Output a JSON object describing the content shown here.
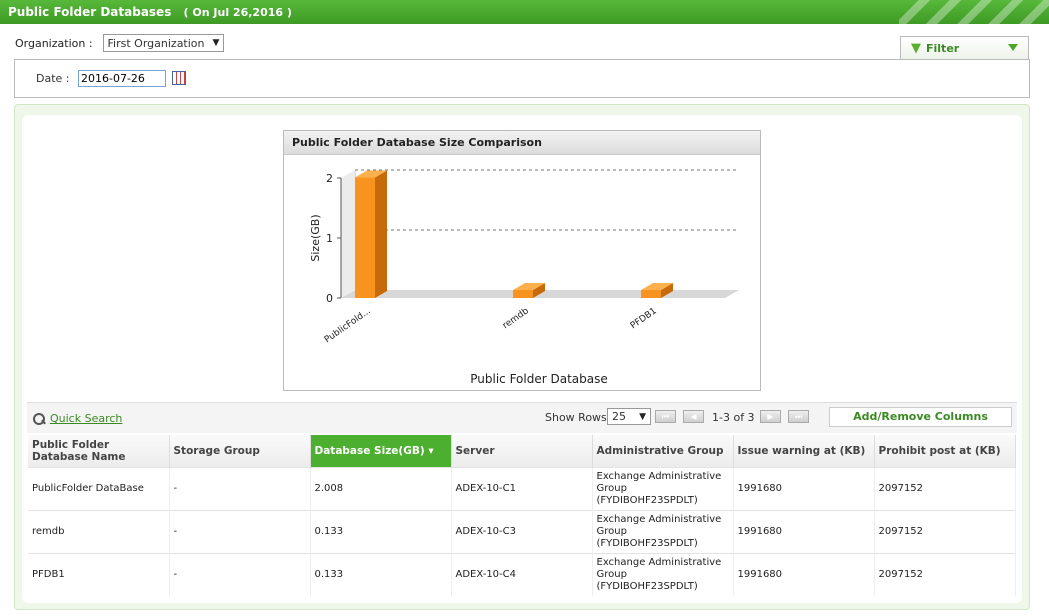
{
  "title_bar": {
    "title": "Public Folder Databases",
    "date_note": "( On Jul 26,2016 )"
  },
  "filters": {
    "organization_label": "Organization :",
    "organization_value": "First Organization",
    "filter_label": "Filter",
    "date_label": "Date :",
    "date_value": "2016-07-26"
  },
  "chart_panel": {
    "header": "Public Folder Database Size Comparison"
  },
  "chart_data": {
    "type": "bar",
    "title": "Public Folder Database Size Comparison",
    "xlabel": "Public Folder Database",
    "ylabel": "Size(GB)",
    "categories": [
      "PublicFold...",
      "remdb",
      "PFDB1"
    ],
    "values": [
      2.008,
      0.133,
      0.133
    ],
    "ylim": [
      0,
      2
    ],
    "yticks": [
      "0",
      "1",
      "2"
    ],
    "grid": true,
    "bar_color": "#f7931e",
    "bar_side_color": "#c76a0a"
  },
  "grid_toolbar": {
    "quick_search": "Quick Search",
    "show_rows_label": "Show Rows",
    "rows_value": "25",
    "page_info": "1-3 of 3",
    "add_remove_columns": "Add/Remove Columns"
  },
  "table": {
    "columns": [
      "Public Folder Database Name",
      "Storage Group",
      "Database Size(GB)",
      "Server",
      "Administrative Group",
      "Issue warning at (KB)",
      "Prohibit post at (KB)"
    ],
    "sorted_column_index": 2,
    "rows": [
      [
        "PublicFolder DataBase",
        "-",
        "2.008",
        "ADEX-10-C1",
        "Exchange Administrative Group (FYDIBOHF23SPDLT)",
        "1991680",
        "2097152"
      ],
      [
        "remdb",
        "-",
        "0.133",
        "ADEX-10-C3",
        "Exchange Administrative Group (FYDIBOHF23SPDLT)",
        "1991680",
        "2097152"
      ],
      [
        "PFDB1",
        "-",
        "0.133",
        "ADEX-10-C4",
        "Exchange Administrative Group (FYDIBOHF23SPDLT)",
        "1991680",
        "2097152"
      ]
    ]
  },
  "colors": {
    "brand_green": "#4caf30",
    "link_green": "#3b8a24"
  }
}
